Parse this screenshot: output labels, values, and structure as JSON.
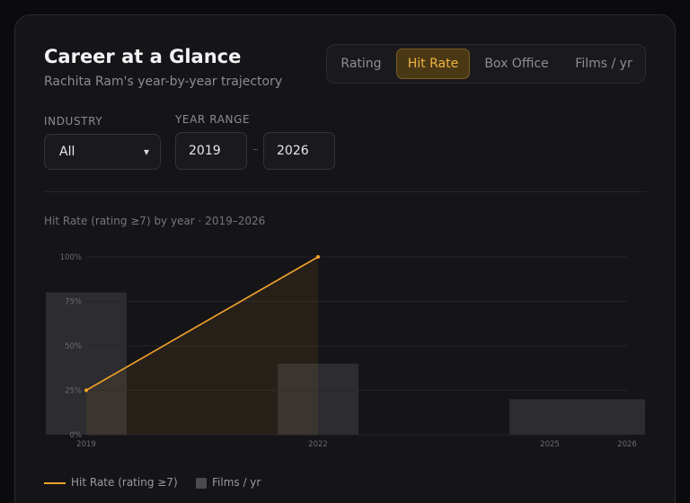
{
  "header": {
    "title": "Career at a Glance",
    "subtitle": "Rachita Ram's year-by-year trajectory"
  },
  "metric_tabs": [
    {
      "label": "Rating",
      "active": false
    },
    {
      "label": "Hit Rate",
      "active": true
    },
    {
      "label": "Box Office",
      "active": false
    },
    {
      "label": "Films / yr",
      "active": false
    }
  ],
  "filters": {
    "industry_label": "INDUSTRY",
    "industry_value": "All",
    "year_range_label": "YEAR RANGE",
    "year_from": "2019",
    "year_to": "2026",
    "range_separator": "–"
  },
  "chart_caption": "Hit Rate (rating ≥7) by year · 2019–2026",
  "legend": {
    "line_label": "Hit Rate (rating ≥7)",
    "bar_label": "Films / yr"
  },
  "colors": {
    "accent": "#f2a22a",
    "bars": "#2c2c31"
  },
  "chart_data": {
    "type": "line",
    "x": [
      2019,
      2022
    ],
    "xlim": [
      2019,
      2026
    ],
    "x_ticks": [
      "2019",
      "2022",
      "2025",
      "2026"
    ],
    "ylim": [
      0,
      100
    ],
    "y_ticks": [
      "0%",
      "25%",
      "50%",
      "75%",
      "100%"
    ],
    "series": [
      {
        "name": "Hit Rate (rating ≥7)",
        "x": [
          2019,
          2022
        ],
        "values": [
          25,
          100
        ]
      }
    ],
    "bars": {
      "name": "Films / yr",
      "x": [
        2019,
        2022,
        2025,
        2026
      ],
      "values": [
        4,
        2,
        1,
        1
      ]
    },
    "grid": true
  }
}
